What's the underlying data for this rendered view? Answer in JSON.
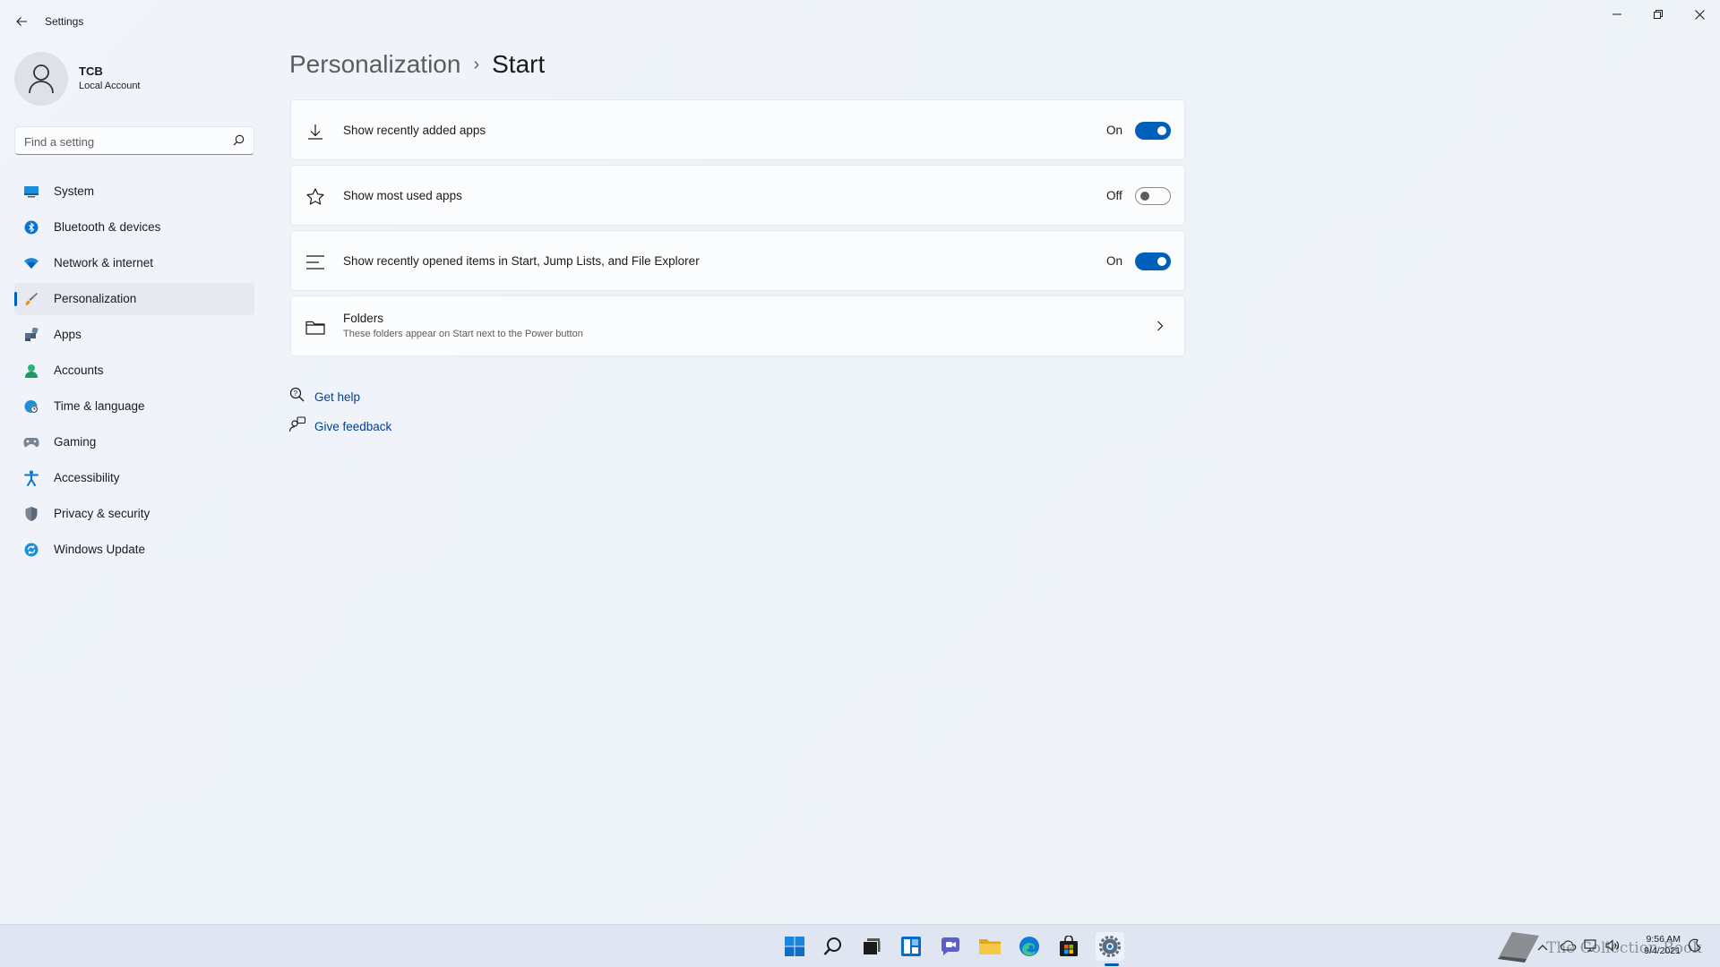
{
  "window": {
    "app_title": "Settings"
  },
  "profile": {
    "name": "TCB",
    "account_type": "Local Account"
  },
  "search": {
    "placeholder": "Find a setting",
    "value": ""
  },
  "sidebar": {
    "items": [
      {
        "label": "System",
        "icon": "system-icon",
        "active": false
      },
      {
        "label": "Bluetooth & devices",
        "icon": "bluetooth-icon",
        "active": false
      },
      {
        "label": "Network & internet",
        "icon": "wifi-icon",
        "active": false
      },
      {
        "label": "Personalization",
        "icon": "brush-icon",
        "active": true
      },
      {
        "label": "Apps",
        "icon": "apps-icon",
        "active": false
      },
      {
        "label": "Accounts",
        "icon": "person-icon",
        "active": false
      },
      {
        "label": "Time & language",
        "icon": "globe-clock-icon",
        "active": false
      },
      {
        "label": "Gaming",
        "icon": "gamepad-icon",
        "active": false
      },
      {
        "label": "Accessibility",
        "icon": "accessibility-icon",
        "active": false
      },
      {
        "label": "Privacy & security",
        "icon": "shield-icon",
        "active": false
      },
      {
        "label": "Windows Update",
        "icon": "update-icon",
        "active": false
      }
    ]
  },
  "breadcrumb": {
    "parent": "Personalization",
    "separator": "›",
    "current": "Start"
  },
  "settings": {
    "recent_apps": {
      "label": "Show recently added apps",
      "state": "On",
      "icon": "download-icon"
    },
    "most_used": {
      "label": "Show most used apps",
      "state": "Off",
      "icon": "star-icon"
    },
    "recent_items": {
      "label": "Show recently opened items in Start, Jump Lists, and File Explorer",
      "state": "On",
      "icon": "list-icon"
    },
    "folders": {
      "label": "Folders",
      "description": "These folders appear on Start next to the Power button",
      "icon": "folder-icon"
    }
  },
  "help": {
    "get_help": "Get help",
    "give_feedback": "Give feedback"
  },
  "taskbar": {
    "icons": [
      "start-icon",
      "search-icon",
      "task-view-icon",
      "widgets-icon",
      "chat-icon",
      "file-explorer-icon",
      "edge-icon",
      "store-icon",
      "settings-icon"
    ],
    "active": "settings-icon"
  },
  "tray": {
    "time": "9:56 AM",
    "date": "9/4/2021",
    "watermark": "The Collection Book"
  },
  "colors": {
    "accent": "#005fb8",
    "link": "#003e92",
    "background": "#eef2f8"
  }
}
